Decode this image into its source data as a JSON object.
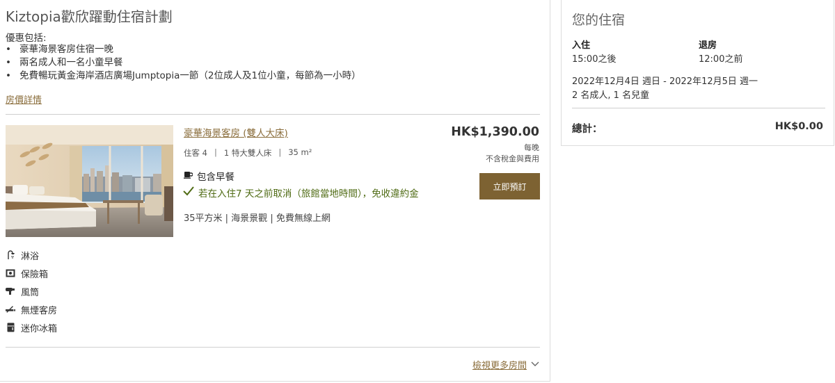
{
  "plan": {
    "title": "Kiztopia歡欣躍動住宿計劃",
    "offers_heading": "優惠包括:",
    "offers": [
      "豪華海景客房住宿一晚",
      "兩名成人和一名小童早餐",
      "免費暢玩黃金海岸酒店廣場Jumptopia一節（2位成人及1位小童，每節為一小時）"
    ],
    "rate_details_link": "房價詳情"
  },
  "room": {
    "name": "豪華海景客房 (雙人大床)",
    "specs": [
      "住客 4",
      "1 特大雙人床",
      "35 m²"
    ],
    "spec_separator": "|",
    "breakfast": "包含早餐",
    "cancel_policy": "若在入住7 天之前取消（旅館當地時間），免收違約金",
    "features": "35平方米 | 海景景觀 | 免費無線上網",
    "price": "HK$1,390.00",
    "per_night": "每晚",
    "tax_note": "不含稅金與費用",
    "book_button": "立即預訂",
    "accent_color": "#7d6232",
    "link_color": "#8a6d3b",
    "policy_color": "#4f6b14"
  },
  "amenities": [
    {
      "label": "淋浴",
      "icon": "shower-icon"
    },
    {
      "label": "保險箱",
      "icon": "safe-icon"
    },
    {
      "label": "風筒",
      "icon": "hairdryer-icon"
    },
    {
      "label": "無煙客房",
      "icon": "no-smoking-icon"
    },
    {
      "label": "迷你冰箱",
      "icon": "minibar-icon"
    }
  ],
  "more_rooms_link": "檢視更多房間",
  "stay": {
    "title": "您的住宿",
    "checkin_label": "入住",
    "checkin_time": "15:00之後",
    "checkout_label": "退房",
    "checkout_time": "12:00之前",
    "date_range": "2022年12月4日 週日 - 2022年12月5日 週一",
    "guests": "2 名成人, 1 名兒童",
    "total_label": "總計：",
    "total_value": "HK$0.00"
  }
}
